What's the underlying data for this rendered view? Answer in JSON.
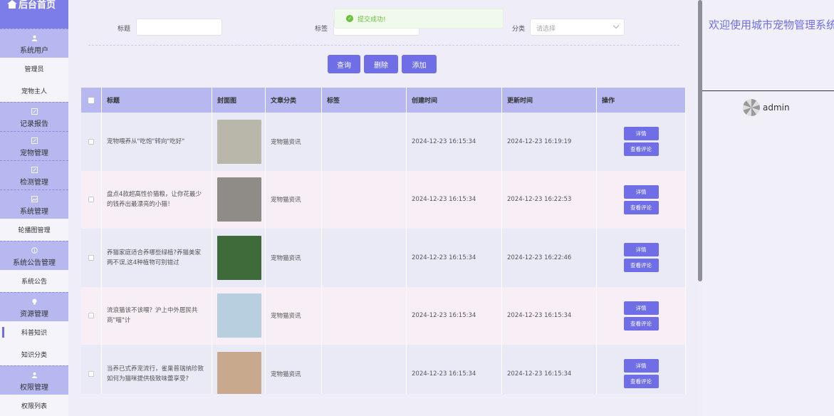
{
  "brand": "后台首页",
  "sidebar": [
    {
      "type": "group",
      "label": "系统用户",
      "icon": "user-icon"
    },
    {
      "type": "sub",
      "label": "管理员"
    },
    {
      "type": "sub",
      "label": "宠物主人"
    },
    {
      "type": "group",
      "label": "记录报告",
      "icon": "edit-icon"
    },
    {
      "type": "group",
      "label": "宠物管理",
      "icon": "edit-icon"
    },
    {
      "type": "group",
      "label": "检测管理",
      "icon": "edit-icon"
    },
    {
      "type": "group",
      "label": "系统管理",
      "icon": "picture-icon"
    },
    {
      "type": "sub",
      "label": "轮播图管理"
    },
    {
      "type": "group",
      "label": "系统公告管理",
      "icon": "info-icon"
    },
    {
      "type": "sub",
      "label": "系统公告"
    },
    {
      "type": "group",
      "label": "资源管理",
      "icon": "bulb-icon"
    },
    {
      "type": "sub",
      "label": "科普知识",
      "active": true
    },
    {
      "type": "sub",
      "label": "知识分类"
    },
    {
      "type": "group",
      "label": "权限管理",
      "icon": "user-icon"
    },
    {
      "type": "sub",
      "label": "权限列表"
    }
  ],
  "filters": {
    "title_label": "标题",
    "tag_label": "标签",
    "category_label": "分类",
    "category_placeholder": "请选择"
  },
  "toast": "提交成功!",
  "buttons": {
    "search": "查询",
    "delete": "删除",
    "add": "添加"
  },
  "table": {
    "headers": [
      "标题",
      "封面图",
      "文章分类",
      "标签",
      "创建时间",
      "更新时间",
      "操作"
    ],
    "rows": [
      {
        "title": "宠物喂养从\"吃饱\"转向\"吃好\"",
        "category": "宠物猫资讯",
        "tag": "",
        "created": "2024-12-23 16:15:34",
        "updated": "2024-12-23 16:19:19",
        "cover_color": "#b9b6aa"
      },
      {
        "title": "盘点4款超高性价猫粮，让你花最少的钱养出最漂亮的小猫！",
        "category": "宠物猫资讯",
        "tag": "",
        "created": "2024-12-23 16:15:34",
        "updated": "2024-12-23 16:22:53",
        "cover_color": "#8f8c87"
      },
      {
        "title": "养猫家庭适合养哪些绿植?养猫美家两不误,这4种植物可别错过",
        "category": "宠物猫资讯",
        "tag": "",
        "created": "2024-12-23 16:15:34",
        "updated": "2024-12-23 16:22:46",
        "cover_color": "#3f6b3a"
      },
      {
        "title": "流浪猫该不该喂？沪上中外居民共商\"喵\"计",
        "category": "宠物猫资讯",
        "tag": "",
        "created": "2024-12-23 16:15:34",
        "updated": "2024-12-23 16:15:34",
        "cover_color": "#b8cfe0"
      },
      {
        "title": "当养已式养宠流行，雀巢普瑞纳珍致如何为猫咪提供极致味蕾享受?",
        "category": "宠物猫资讯",
        "tag": "",
        "created": "2024-12-23 16:15:34",
        "updated": "2024-12-23 16:15:34",
        "cover_color": "#c9a98e"
      }
    ],
    "detail_label": "详情",
    "comment_label": "查看评论"
  },
  "right": {
    "welcome": "欢迎使用城市宠物管理系统",
    "username": "admin"
  }
}
